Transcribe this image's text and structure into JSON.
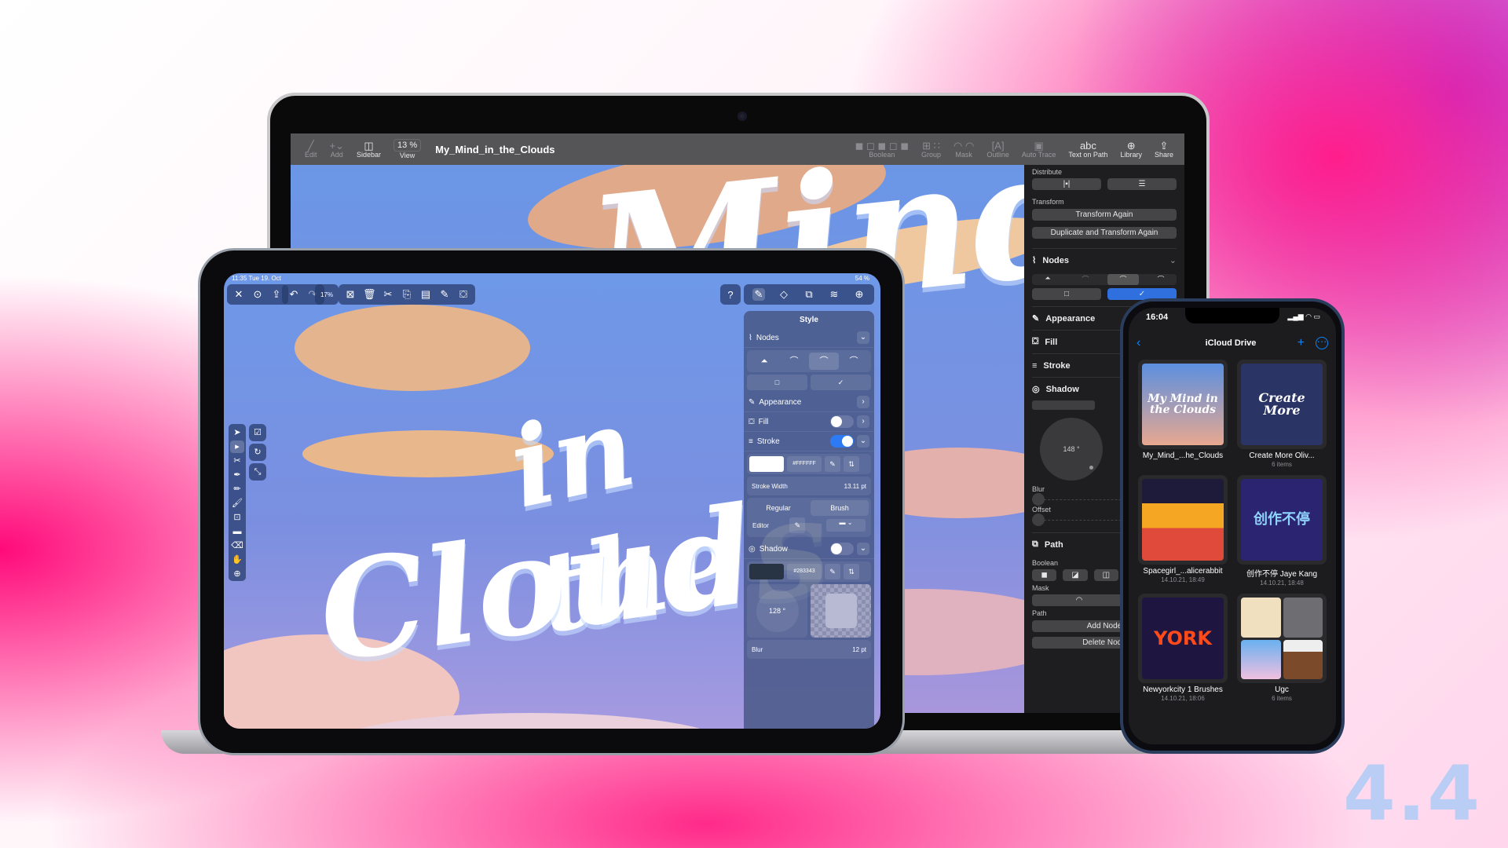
{
  "version_badge": "4.4",
  "mac": {
    "toolbar": {
      "items_left": [
        {
          "icon": "pencil-icon",
          "label": "Edit"
        },
        {
          "icon": "plus-icon",
          "label": "Add"
        },
        {
          "icon": "sidebar-icon",
          "label": "Sidebar"
        }
      ],
      "zoom_value": "13 %",
      "zoom_label": "View",
      "document_title": "My_Mind_in_the_Clouds",
      "items_right": [
        {
          "icon": "boolean-icon",
          "label": "Boolean"
        },
        {
          "icon": "group-icon",
          "label": "Group"
        },
        {
          "icon": "mask-icon",
          "label": "Mask"
        },
        {
          "icon": "outline-icon",
          "label": "Outline"
        },
        {
          "icon": "auto-trace-icon",
          "label": "Auto Trace"
        },
        {
          "icon": "text-on-path-icon",
          "label": "Text on Path",
          "glyph": "abc"
        },
        {
          "icon": "library-icon",
          "label": "Library"
        },
        {
          "icon": "share-icon",
          "label": "Share"
        }
      ]
    },
    "sidebar": {
      "distribute_label": "Distribute",
      "transform_label": "Transform",
      "transform_again": "Transform Again",
      "duplicate_transform": "Duplicate and Transform Again",
      "nodes": "Nodes",
      "appearance": "Appearance",
      "fill": "Fill",
      "stroke": "Stroke",
      "shadow": "Shadow",
      "shadow_angle": "148 °",
      "blur_label": "Blur",
      "offset_label": "Offset",
      "path": "Path",
      "boolean_label": "Boolean",
      "mask_label": "Mask",
      "path_label": "Path",
      "add_node": "Add Node",
      "delete_node": "Delete Node"
    },
    "canvas_text": [
      "Mind",
      "in the",
      "Clouds"
    ]
  },
  "ipad": {
    "status_time": "11:35  Tue 19. Oct",
    "status_battery": "54 %",
    "zoom": "17%",
    "help": "?",
    "panel": {
      "title": "Style",
      "nodes": "Nodes",
      "appearance": "Appearance",
      "fill": "Fill",
      "fill_enabled": false,
      "stroke": "Stroke",
      "stroke_enabled": true,
      "stroke_hex": "#FFFFFF",
      "stroke_width_label": "Stroke Width",
      "stroke_width_value": "13.11 pt",
      "mode_regular": "Regular",
      "mode_brush": "Brush",
      "editor_label": "Editor",
      "shadow": "Shadow",
      "shadow_enabled": false,
      "shadow_hex": "#283343",
      "shadow_angle": "128 °",
      "blur_label": "Blur",
      "blur_value": "12 pt"
    }
  },
  "iphone": {
    "time": "16:04",
    "title": "iCloud Drive",
    "files": [
      {
        "name": "My_Mind_...he_Clouds",
        "sub": "",
        "art": "My Mind in the Clouds",
        "color": "#5b8fe0"
      },
      {
        "name": "Create More Oliv...",
        "sub": "6 items",
        "art": "Create More",
        "color": "#2a3566"
      },
      {
        "name": "Spacegirl_...alicerabbit",
        "sub": "14.10.21, 18:49",
        "art": "",
        "color": "#f5a623"
      },
      {
        "name": "创作不停 Jaye Kang",
        "sub": "14.10.21, 18:48",
        "art": "创作不停",
        "color": "#2b2470"
      },
      {
        "name": "Newyorkcity 1 Brushes",
        "sub": "14.10.21, 18:06",
        "art": "YORK",
        "color": "#1e1640"
      },
      {
        "name": "Ugc",
        "sub": "6 items",
        "art": "",
        "color": "#3a3a3c"
      }
    ]
  }
}
